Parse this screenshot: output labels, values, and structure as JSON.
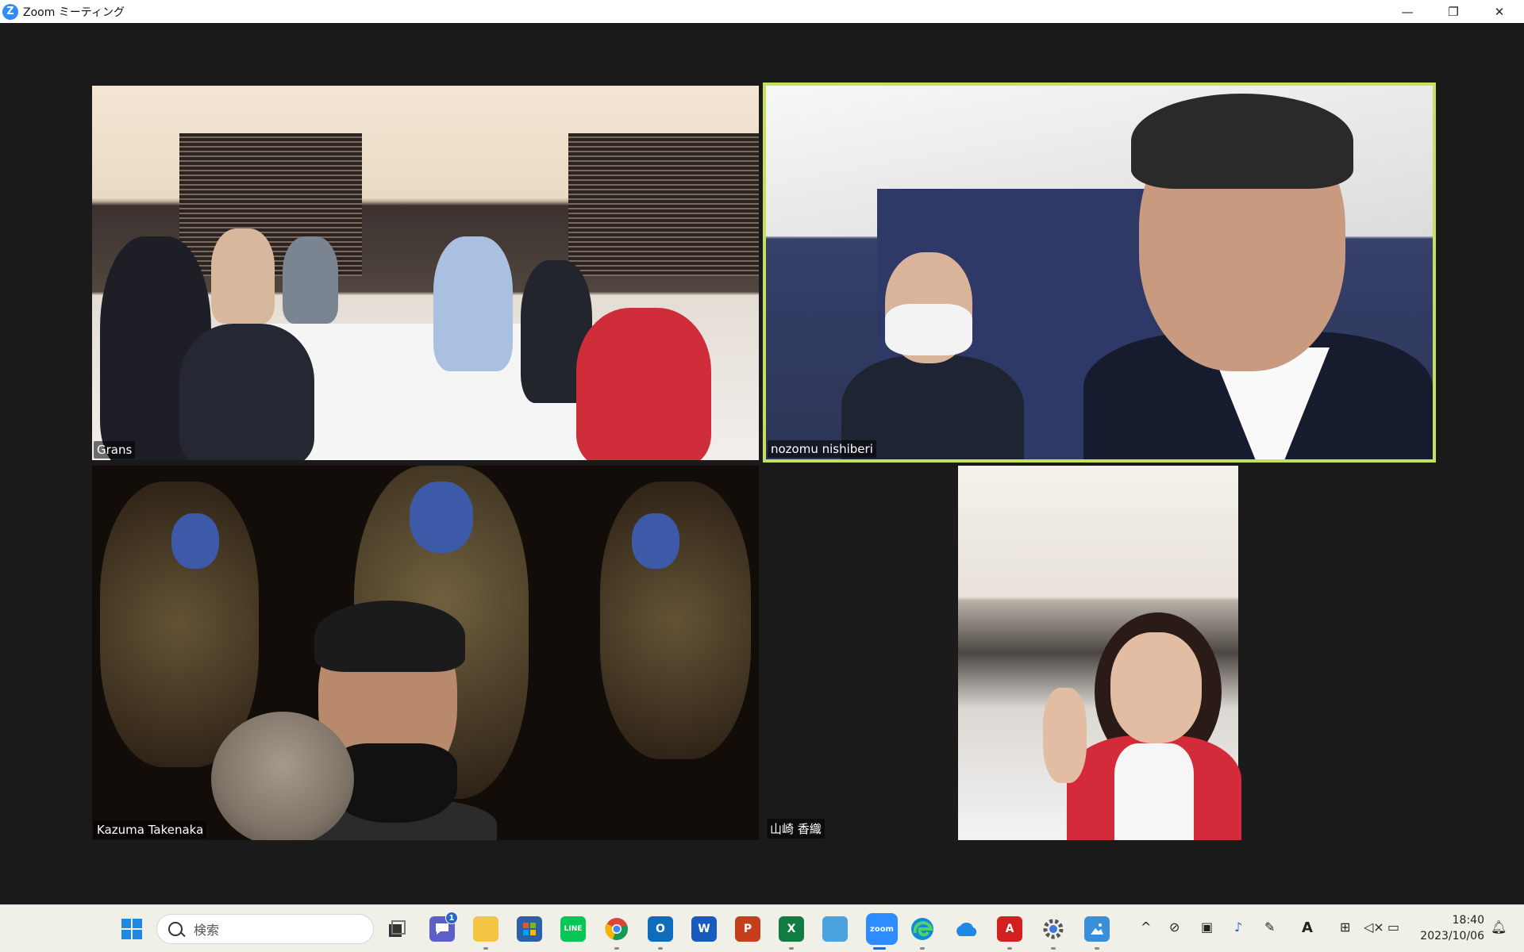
{
  "window": {
    "title": "Zoom ミーティング",
    "logo_letter": "Z",
    "minimize": "—",
    "restore": "❐",
    "close": "✕"
  },
  "participants": [
    {
      "name": "Grans",
      "active_speaker": false
    },
    {
      "name": "nozomu nishiberi",
      "active_speaker": true
    },
    {
      "name": "Kazuma Takenaka",
      "active_speaker": false
    },
    {
      "name": "山崎 香織",
      "active_speaker": false
    }
  ],
  "colors": {
    "active_speaker_border": "#c5e15a",
    "stage_background": "#1a1a1a",
    "zoom_blue": "#2D8CFF"
  },
  "taskbar": {
    "search_placeholder": "検索",
    "chat_badge": "1",
    "apps": [
      "start-icon",
      "search",
      "task-view-icon",
      "teams-chat-icon",
      "file-explorer-icon",
      "microsoft-store-icon",
      "line-icon",
      "chrome-icon",
      "outlook-icon",
      "word-icon",
      "powerpoint-icon",
      "excel-icon",
      "control-panel-icon",
      "zoom-icon",
      "edge-icon",
      "onedrive-icon",
      "acrobat-icon",
      "settings-icon",
      "photos-icon"
    ],
    "app_labels": {
      "line": "LINE",
      "word": "W",
      "powerpoint": "P",
      "excel": "X",
      "zoom": "zoom",
      "acrobat": "A",
      "outlook": "O"
    },
    "tray": {
      "chevron": "^",
      "ime": "A"
    },
    "clock_time": "18:40",
    "clock_date": "2023/10/06"
  }
}
